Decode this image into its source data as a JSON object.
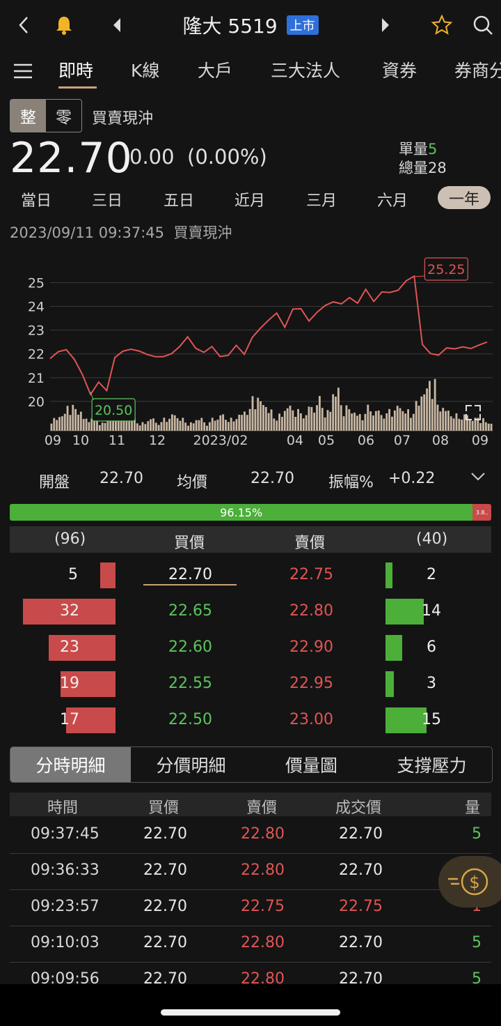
{
  "header": {
    "stock_name": "隆大",
    "stock_code": "5519",
    "market_badge": "上市",
    "icons": [
      "back-icon",
      "bell-icon",
      "prev-stock-icon",
      "next-stock-icon",
      "star-icon",
      "search-icon"
    ]
  },
  "tabs": [
    {
      "label": "即時",
      "active": true
    },
    {
      "label": "K線"
    },
    {
      "label": "大戶"
    },
    {
      "label": "三大法人"
    },
    {
      "label": "資券"
    },
    {
      "label": "券商分"
    }
  ],
  "quote": {
    "mode_a": "整",
    "mode_b": "零",
    "day_trade_label": "買賣現沖",
    "price": "22.70",
    "change": "0.00",
    "change_pct": "(0.00%)",
    "single_vol_label": "單量",
    "single_vol": "5",
    "total_vol_label": "總量",
    "total_vol": "28"
  },
  "periods": [
    "當日",
    "三日",
    "五日",
    "近月",
    "三月",
    "六月",
    "一年"
  ],
  "active_period": "一年",
  "timestamp": "2023/09/11 09:37:45",
  "timestamp_tag": "買賣現沖",
  "chart_data": {
    "type": "line",
    "y_ticks": [
      "25",
      "24",
      "23",
      "22",
      "21",
      "20"
    ],
    "ylim": [
      19.0,
      25.6
    ],
    "x_ticks": [
      "09",
      "10",
      "11",
      "12",
      "2023/02",
      "04",
      "05",
      "06",
      "07",
      "08",
      "09"
    ],
    "high_label": "25.25",
    "low_label": "20.50",
    "price_series": [
      21.8,
      22.0,
      22.3,
      21.7,
      21.1,
      20.4,
      20.7,
      20.5,
      21.9,
      22.0,
      22.3,
      22.1,
      21.9,
      22.0,
      21.8,
      22.0,
      22.4,
      22.6,
      22.3,
      22.1,
      22.2,
      22.0,
      21.9,
      22.3,
      22.1,
      22.6,
      23.1,
      23.5,
      23.6,
      23.2,
      23.9,
      23.8,
      23.5,
      23.7,
      24.0,
      24.3,
      24.0,
      24.4,
      24.2,
      24.6,
      24.3,
      24.6,
      24.5,
      24.8,
      25.0,
      25.25,
      22.5,
      21.9,
      22.0,
      22.3,
      22.1,
      22.4,
      22.2,
      22.3,
      22.5
    ],
    "volume_series": [
      3,
      4,
      6,
      5,
      3,
      4,
      2,
      3,
      5,
      4,
      3,
      2,
      3,
      2,
      3,
      4,
      3,
      2,
      3,
      2,
      3,
      4,
      3,
      4,
      5,
      8,
      7,
      5,
      4,
      6,
      5,
      4,
      6,
      8,
      5,
      10,
      6,
      5,
      4,
      6,
      5,
      4,
      5,
      6,
      5,
      7,
      10,
      12,
      6,
      5,
      4,
      4,
      3,
      3,
      2
    ]
  },
  "stats": {
    "open_label": "開盤",
    "open": "22.70",
    "avg_label": "均價",
    "avg": "22.70",
    "amp_label": "振幅%",
    "amp": "+0.22"
  },
  "ratio": {
    "buy_pct": "96.15%",
    "sell_pct": "3.8..",
    "buy_fraction": 0.9615
  },
  "order_book": {
    "buy_total": "(96)",
    "bid_label": "買價",
    "ask_label": "賣價",
    "sell_total": "(40)",
    "rows": [
      {
        "bid_vol": "5",
        "bid": "22.70",
        "ask": "22.75",
        "ask_vol": "2"
      },
      {
        "bid_vol": "32",
        "bid": "22.65",
        "ask": "22.80",
        "ask_vol": "14"
      },
      {
        "bid_vol": "23",
        "bid": "22.60",
        "ask": "22.90",
        "ask_vol": "6"
      },
      {
        "bid_vol": "19",
        "bid": "22.55",
        "ask": "22.95",
        "ask_vol": "3"
      },
      {
        "bid_vol": "17",
        "bid": "22.50",
        "ask": "23.00",
        "ask_vol": "15"
      }
    ]
  },
  "sub_tabs": [
    {
      "label": "分時明細",
      "active": true
    },
    {
      "label": "分價明細"
    },
    {
      "label": "價量圖"
    },
    {
      "label": "支撐壓力"
    }
  ],
  "trades": {
    "headers": {
      "time": "時間",
      "bid": "買價",
      "ask": "賣價",
      "deal": "成交價",
      "vol": "量"
    },
    "rows": [
      {
        "time": "09:37:45",
        "bid": "22.70",
        "ask": "22.80",
        "deal": "22.70",
        "vol": "5",
        "deal_color": "white",
        "vol_color": "green"
      },
      {
        "time": "09:36:33",
        "bid": "22.70",
        "ask": "22.80",
        "deal": "22.70",
        "vol": "",
        "deal_color": "white",
        "vol_color": "green"
      },
      {
        "time": "09:23:57",
        "bid": "22.70",
        "ask": "22.75",
        "deal": "22.75",
        "vol": "1",
        "deal_color": "red",
        "vol_color": "red"
      },
      {
        "time": "09:10:03",
        "bid": "22.70",
        "ask": "22.80",
        "deal": "22.70",
        "vol": "5",
        "deal_color": "white",
        "vol_color": "green"
      },
      {
        "time": "09:09:56",
        "bid": "22.70",
        "ask": "22.80",
        "deal": "22.70",
        "vol": "5",
        "deal_color": "white",
        "vol_color": "green"
      }
    ]
  },
  "colors": {
    "up": "#e05555",
    "down": "#5cc45c",
    "accent": "#c9a37a"
  }
}
